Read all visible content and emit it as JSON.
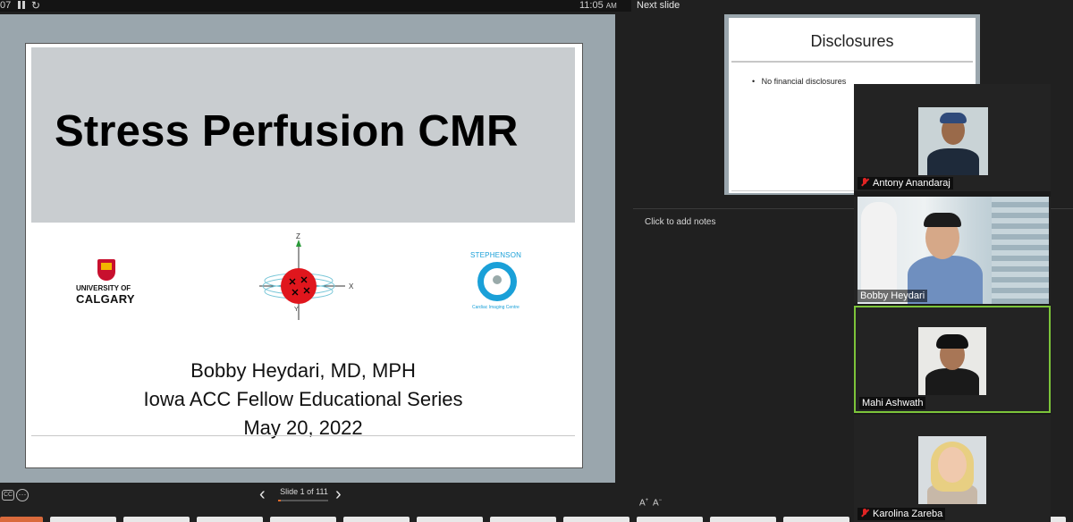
{
  "topbar": {
    "elapsed": "07",
    "clock": "11:05",
    "ampm": "AM"
  },
  "slide": {
    "title": "Stress Perfusion CMR",
    "presenter": "Bobby Heydari, MD, MPH",
    "series": "Iowa ACC Fellow Educational Series",
    "date": "May 20, 2022",
    "uc_logo": {
      "line1": "UNIVERSITY OF",
      "line2": "CALGARY"
    },
    "steph_logo": {
      "name": "STEPHENSON",
      "sub": "Cardiac Imaging Centre"
    },
    "diagram": {
      "z": "Z",
      "x": "X",
      "y": "Y"
    }
  },
  "nav": {
    "cc": "CC",
    "more": "···",
    "prev": "‹",
    "next": "›",
    "counter": "Slide 1 of 111",
    "progress": 0.009
  },
  "next_panel": {
    "label": "Next slide",
    "title": "Disclosures",
    "bullet": "No financial disclosures"
  },
  "notes": {
    "placeholder": "Click to add notes",
    "font_up": "A",
    "font_down": "A"
  },
  "participants": [
    {
      "name": "Antony Anandaraj",
      "muted": true
    },
    {
      "name": "Bobby Heydari",
      "muted": false
    },
    {
      "name": "Mahi Ashwath",
      "muted": false,
      "active": true
    },
    {
      "name": "Karolina Zareba",
      "muted": true
    }
  ],
  "colors": {
    "active_speaker": "#7cc43a",
    "progress": "#e06a2a",
    "stage_bg": "#9aa6ad"
  }
}
